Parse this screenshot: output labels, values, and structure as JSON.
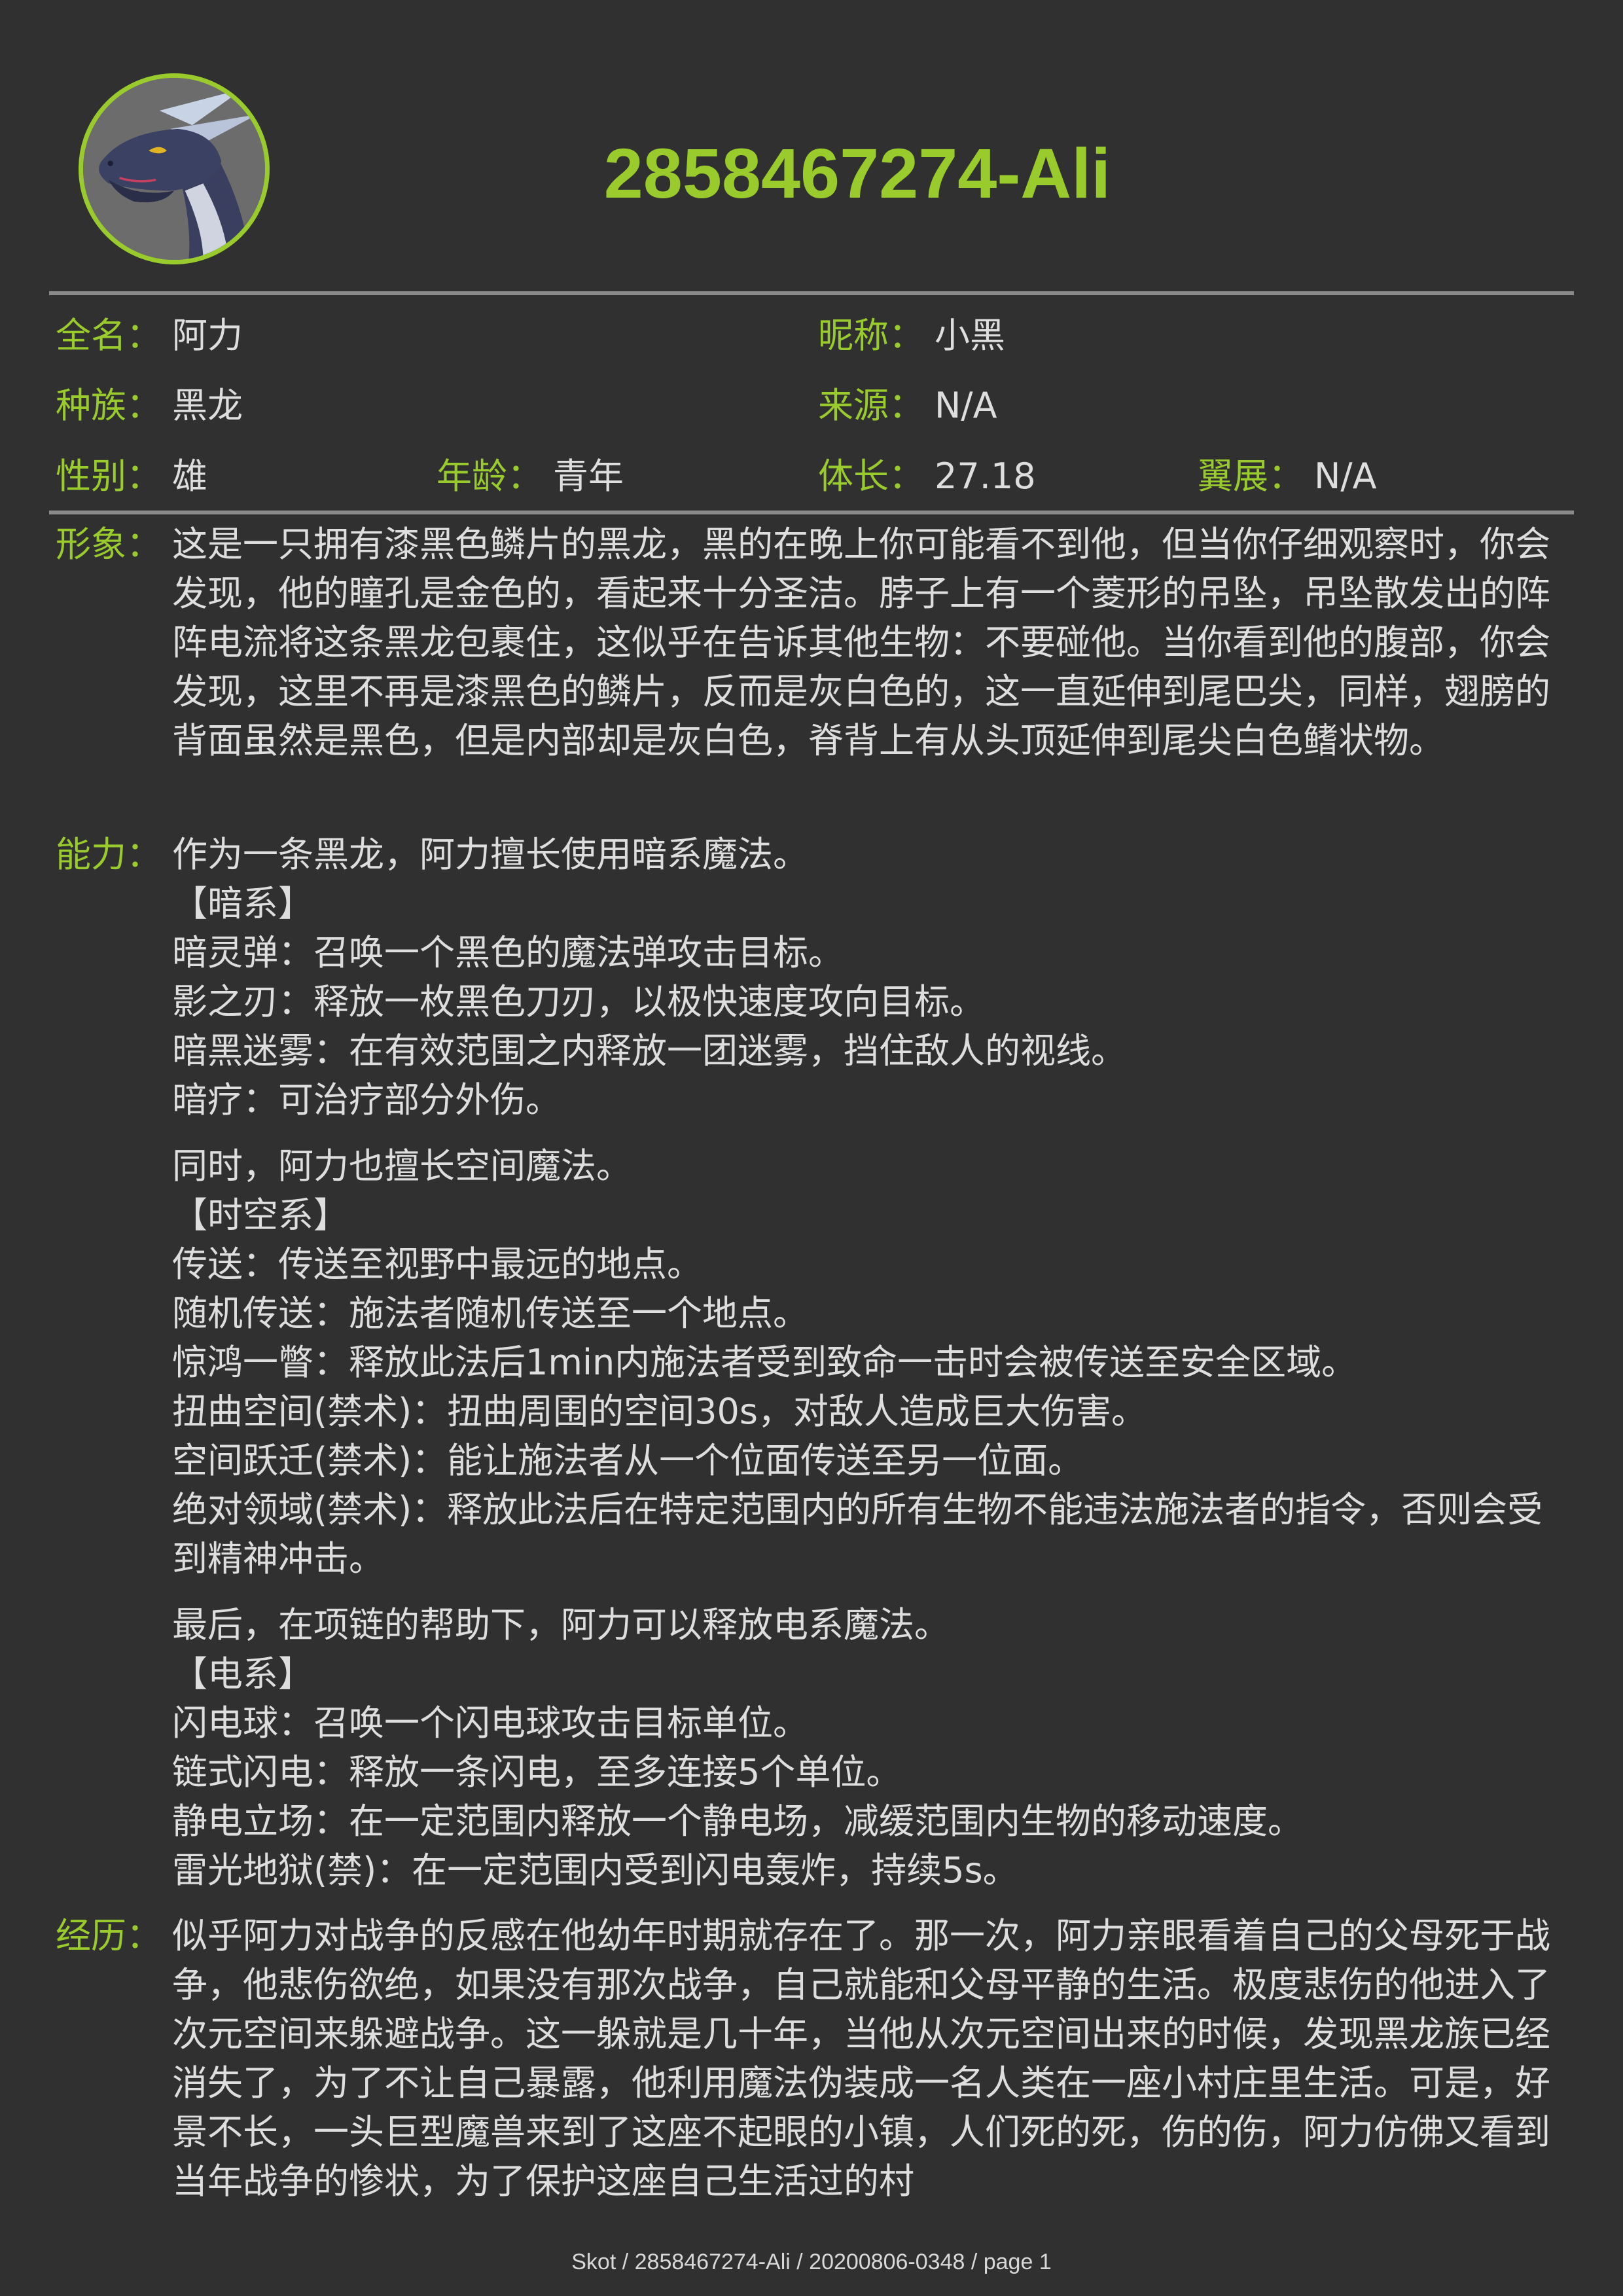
{
  "title": "2858467274-Ali",
  "fields": {
    "fullname": {
      "label": "全名：",
      "value": "阿力"
    },
    "nickname": {
      "label": "昵称：",
      "value": "小黑"
    },
    "species": {
      "label": "种族：",
      "value": "黑龙"
    },
    "source": {
      "label": "来源：",
      "value": "N/A"
    },
    "gender": {
      "label": "性别：",
      "value": "雄"
    },
    "age": {
      "label": "年龄：",
      "value": "青年"
    },
    "length": {
      "label": "体长：",
      "value": "27.18"
    },
    "wingspan": {
      "label": "翼展：",
      "value": "N/A"
    }
  },
  "appearance": {
    "label": "形象：",
    "text": "这是一只拥有漆黑色鳞片的黑龙，黑的在晚上你可能看不到他，但当你仔细观察时，你会发现，他的瞳孔是金色的，看起来十分圣洁。脖子上有一个菱形的吊坠，吊坠散发出的阵阵电流将这条黑龙包裹住，这似乎在告诉其他生物：不要碰他。当你看到他的腹部，你会发现，这里不再是漆黑色的鳞片，反而是灰白色的，这一直延伸到尾巴尖，同样，翅膀的背面虽然是黑色，但是内部却是灰白色，脊背上有从头顶延伸到尾尖白色鳍状物。"
  },
  "abilities": {
    "label": "能力：",
    "groups": [
      {
        "intro": "作为一条黑龙，阿力擅长使用暗系魔法。",
        "category": "【暗系】",
        "items": [
          "暗灵弹：召唤一个黑色的魔法弹攻击目标。",
          "影之刃：释放一枚黑色刀刃，以极快速度攻向目标。",
          "暗黑迷雾：在有效范围之内释放一团迷雾，挡住敌人的视线。",
          "暗疗：可治疗部分外伤。"
        ]
      },
      {
        "intro": "同时，阿力也擅长空间魔法。",
        "category": "【时空系】",
        "items": [
          "传送：传送至视野中最远的地点。",
          "随机传送：施法者随机传送至一个地点。",
          "惊鸿一瞥：释放此法后1min内施法者受到致命一击时会被传送至安全区域。",
          "扭曲空间(禁术)：扭曲周围的空间30s，对敌人造成巨大伤害。",
          "空间跃迁(禁术)：能让施法者从一个位面传送至另一位面。",
          "绝对领域(禁术)：释放此法后在特定范围内的所有生物不能违法施法者的指令，否则会受到精神冲击。"
        ]
      },
      {
        "intro": "最后，在项链的帮助下，阿力可以释放电系魔法。",
        "category": "【电系】",
        "items": [
          "闪电球：召唤一个闪电球攻击目标单位。",
          "链式闪电：释放一条闪电，至多连接5个单位。",
          "静电立场：在一定范围内释放一个静电场，减缓范围内生物的移动速度。",
          "雷光地狱(禁)：在一定范围内受到闪电轰炸，持续5s。"
        ]
      }
    ]
  },
  "history": {
    "label": "经历：",
    "text": "似乎阿力对战争的反感在他幼年时期就存在了。那一次，阿力亲眼看着自己的父母死于战争，他悲伤欲绝，如果没有那次战争，自己就能和父母平静的生活。极度悲伤的他进入了次元空间来躲避战争。这一躲就是几十年，当他从次元空间出来的时候，发现黑龙族已经消失了，为了不让自己暴露，他利用魔法伪装成一名人类在一座小村庄里生活。可是，好景不长，一头巨型魔兽来到了这座不起眼的小镇，人们死的死，伤的伤，阿力仿佛又看到当年战争的惨状，为了保护这座自己生活过的村"
  },
  "footer": "Skot / 2858467274-Ali / 20200806-0348 / page 1",
  "colors": {
    "background": "#303030",
    "accent": "#9acb2c",
    "text": "#dedede",
    "rule": "#8a8a8a"
  },
  "avatar_icon": "black-dragon-avatar"
}
